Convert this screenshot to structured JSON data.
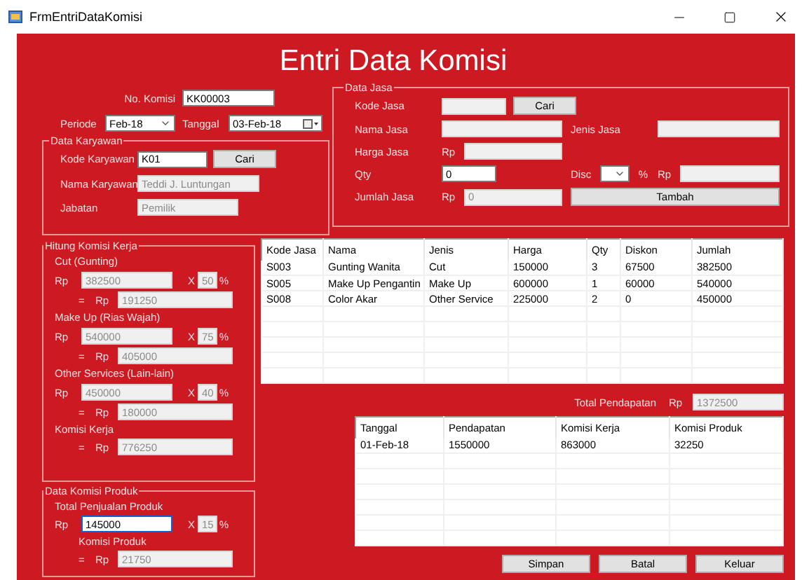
{
  "window": {
    "title": "FrmEntriDataKomisi"
  },
  "heading": "Entri Data Komisi",
  "header": {
    "no_komisi": {
      "label": "No. Komisi",
      "value": "KK00003"
    },
    "periode": {
      "label": "Periode",
      "value": "Feb-18"
    },
    "tanggal": {
      "label": "Tanggal",
      "value": "03-Feb-18"
    }
  },
  "data_karyawan": {
    "title": "Data Karyawan",
    "fields": [
      {
        "label": "Kode Karyawan",
        "value": "K01",
        "disabled": false,
        "button": "Cari"
      },
      {
        "label": "Nama Karyawan",
        "value": "Teddi J. Luntungan",
        "disabled": true
      },
      {
        "label": "Jabatan",
        "value": "Pemilik",
        "disabled": true
      }
    ]
  },
  "data_jasa": {
    "title": "Data Jasa",
    "kode_jasa": {
      "label": "Kode Jasa",
      "disabled": true,
      "button": "Cari"
    },
    "nama_jasa": {
      "label": "Nama Jasa",
      "disabled": true
    },
    "jenis_jasa": {
      "label": "Jenis Jasa",
      "disabled": true
    },
    "harga_jasa": {
      "label": "Harga Jasa",
      "currency": "Rp",
      "disabled": true
    },
    "qty": {
      "label": "Qty",
      "value": "0",
      "disabled": false
    },
    "disc": {
      "label": "Disc",
      "percent_sign": "%",
      "currency": "Rp",
      "disabled": true
    },
    "jumlah_jasa": {
      "label": "Jumlah Jasa",
      "currency": "Rp",
      "value": "0",
      "disabled": true
    },
    "add_button": "Tambah"
  },
  "hitung_komisi": {
    "title": "Hitung Komisi Kerja",
    "items": [
      {
        "label": "Cut (Gunting)",
        "currency": "Rp",
        "amount": "382500",
        "times": "X",
        "percent": "50",
        "percent_sign": "%",
        "equals": "=",
        "result_currency": "Rp",
        "result": "191250"
      },
      {
        "label": "Make Up (Rias Wajah)",
        "currency": "Rp",
        "amount": "540000",
        "times": "X",
        "percent": "75",
        "percent_sign": "%",
        "equals": "=",
        "result_currency": "Rp",
        "result": "405000"
      },
      {
        "label": "Other Services (Lain-lain)",
        "currency": "Rp",
        "amount": "450000",
        "times": "X",
        "percent": "40",
        "percent_sign": "%",
        "equals": "=",
        "result_currency": "Rp",
        "result": "180000"
      }
    ],
    "total": {
      "label": "Komisi Kerja",
      "equals": "=",
      "currency": "Rp",
      "value": "776250"
    }
  },
  "komisi_produk": {
    "title": "Data Komisi Produk",
    "label": "Total Penjualan Produk",
    "currency": "Rp",
    "amount": "145000",
    "focused": true,
    "times": "X",
    "percent": "15",
    "percent_sign": "%",
    "result_label": "Komisi Produk",
    "equals": "=",
    "result_currency": "Rp",
    "result": "21750"
  },
  "jasa_table": {
    "columns": [
      "Kode Jasa",
      "Nama",
      "Jenis",
      "Harga",
      "Qty",
      "Diskon",
      "Jumlah"
    ],
    "rows": [
      [
        "S003",
        "Gunting Wanita",
        "Cut",
        "150000",
        "3",
        "67500",
        "382500"
      ],
      [
        "S005",
        "Make Up Pengantin",
        "Make Up",
        "600000",
        "1",
        "60000",
        "540000"
      ],
      [
        "S008",
        "Color Akar",
        "Other Service",
        "225000",
        "2",
        "0",
        "450000"
      ]
    ]
  },
  "total_pendapatan": {
    "label": "Total Pendapatan",
    "currency": "Rp",
    "value": "1372500"
  },
  "komisi_table": {
    "columns": [
      "Tanggal",
      "Pendapatan",
      "Komisi Kerja",
      "Komisi Produk"
    ],
    "rows": [
      [
        "01-Feb-18",
        "1550000",
        "863000",
        "32250"
      ]
    ]
  },
  "buttons": [
    "Simpan",
    "Batal",
    "Keluar"
  ]
}
